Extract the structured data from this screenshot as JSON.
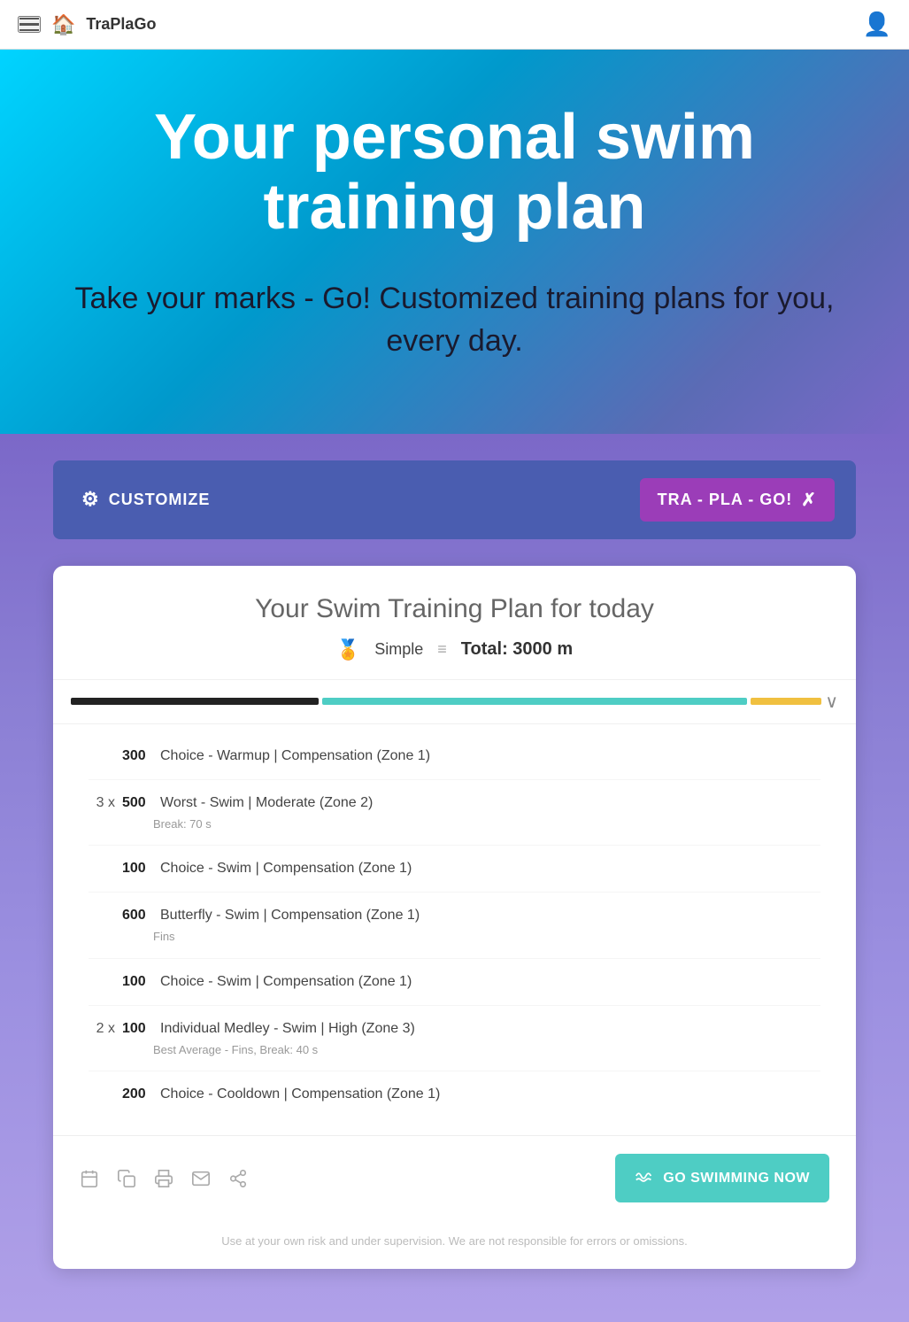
{
  "header": {
    "app_name": "TraPlaGo",
    "home_icon": "🏠"
  },
  "hero": {
    "title": "Your personal swim training plan",
    "subtitle": "Take your marks - Go! Customized training plans for you, every day."
  },
  "toolbar": {
    "customize_label": "CUSTOMIZE",
    "traplago_label": "TRA - PLA - GO!"
  },
  "plan": {
    "title": "Your Swim Training Plan for today",
    "level": "Simple",
    "total": "Total: 3000 m",
    "items": [
      {
        "repeat": "",
        "distance": "300",
        "description": "Choice - Warmup | Compensation (Zone 1)",
        "detail": ""
      },
      {
        "repeat": "3 x",
        "distance": "500",
        "description": "Worst - Swim | Moderate (Zone 2)",
        "detail": "Break: 70 s"
      },
      {
        "repeat": "",
        "distance": "100",
        "description": "Choice - Swim | Compensation (Zone 1)",
        "detail": ""
      },
      {
        "repeat": "",
        "distance": "600",
        "description": "Butterfly - Swim | Compensation (Zone 1)",
        "detail": "Fins"
      },
      {
        "repeat": "",
        "distance": "100",
        "description": "Choice - Swim | Compensation (Zone 1)",
        "detail": ""
      },
      {
        "repeat": "2 x",
        "distance": "100",
        "description": "Individual Medley - Swim | High (Zone 3)",
        "detail": "Best Average - Fins, Break: 40 s"
      },
      {
        "repeat": "",
        "distance": "200",
        "description": "Choice - Cooldown | Compensation (Zone 1)",
        "detail": ""
      }
    ],
    "go_swimming_label": "GO SWIMMING NOW",
    "disclaimer": "Use at your own risk and under supervision. We are not responsible for errors or omissions."
  }
}
